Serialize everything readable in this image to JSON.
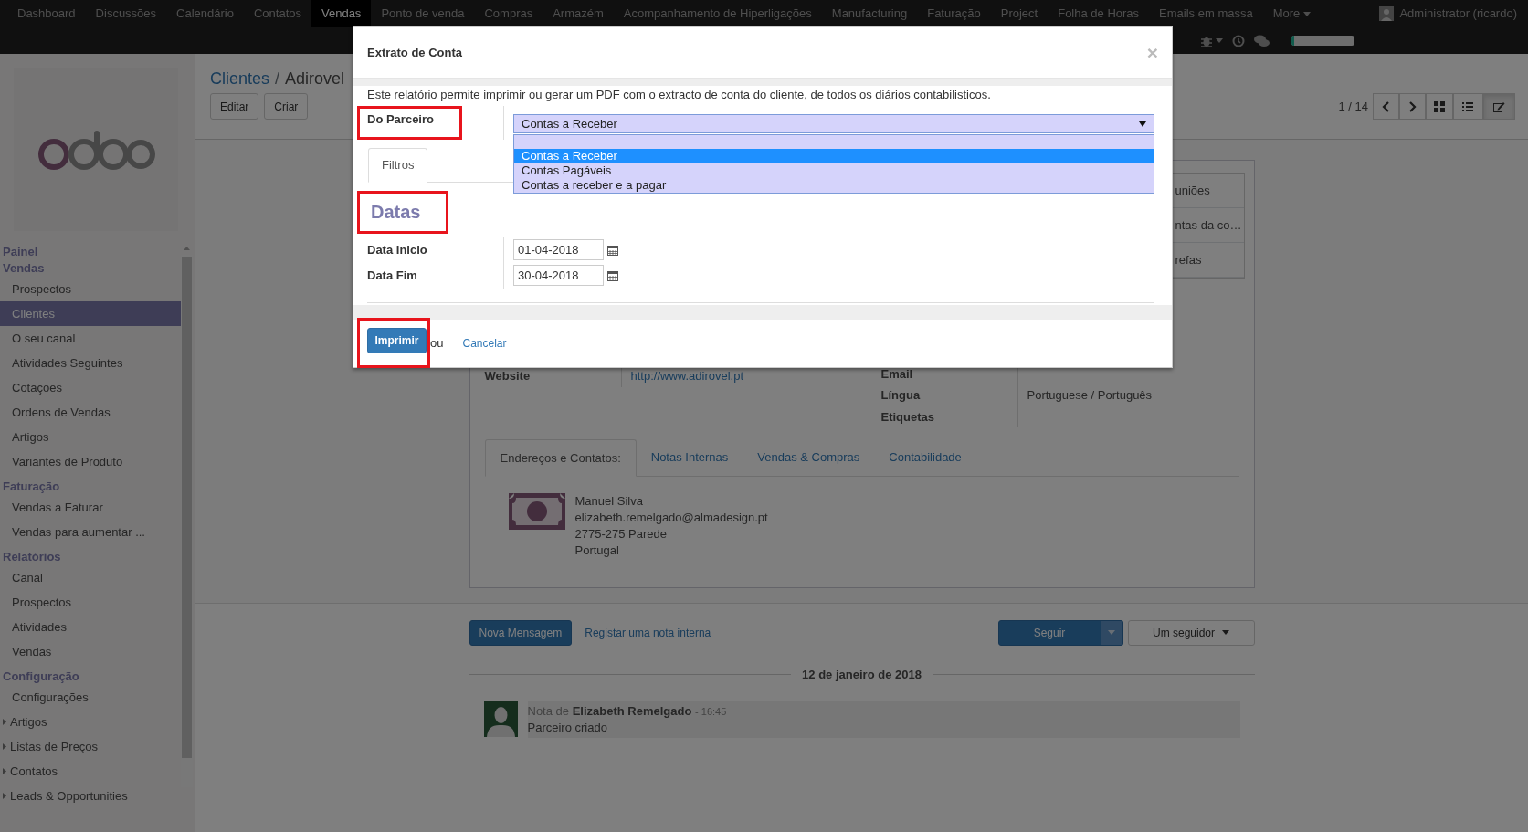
{
  "navbar": {
    "menu": [
      {
        "label": "Dashboard",
        "selected": false
      },
      {
        "label": "Discussões",
        "selected": false
      },
      {
        "label": "Calendário",
        "selected": false
      },
      {
        "label": "Contatos",
        "selected": false
      },
      {
        "label": "Vendas",
        "selected": true
      },
      {
        "label": "Ponto de venda",
        "selected": false
      },
      {
        "label": "Compras",
        "selected": false
      },
      {
        "label": "Armazém",
        "selected": false
      },
      {
        "label": "Acompanhamento de Hiperligações",
        "selected": false
      },
      {
        "label": "Manufacturing",
        "selected": false
      },
      {
        "label": "Faturação",
        "selected": false
      },
      {
        "label": "Project",
        "selected": false
      },
      {
        "label": "Folha de Horas",
        "selected": false
      },
      {
        "label": "Emails em massa",
        "selected": false
      }
    ],
    "more": "More",
    "user": "Administrator (ricardo)",
    "planner": {
      "level": 0.04
    }
  },
  "sidebar": {
    "sections": [
      {
        "title": "Painel"
      },
      {
        "title": "Vendas",
        "items": [
          {
            "label": "Prospectos",
            "selected": false,
            "expandable": false
          },
          {
            "label": "Clientes",
            "selected": true,
            "expandable": false
          },
          {
            "label": "O seu canal",
            "selected": false,
            "expandable": false
          },
          {
            "label": "Atividades Seguintes",
            "selected": false,
            "expandable": false
          },
          {
            "label": "Cotações",
            "selected": false,
            "expandable": false
          },
          {
            "label": "Ordens de Vendas",
            "selected": false,
            "expandable": false
          },
          {
            "label": "Artigos",
            "selected": false,
            "expandable": false
          },
          {
            "label": "Variantes de Produto",
            "selected": false,
            "expandable": false
          }
        ]
      },
      {
        "title": "Faturação",
        "items": [
          {
            "label": "Vendas a Faturar",
            "selected": false,
            "expandable": false
          },
          {
            "label": "Vendas para aumentar ...",
            "selected": false,
            "expandable": false
          }
        ]
      },
      {
        "title": "Relatórios",
        "items": [
          {
            "label": "Canal",
            "selected": false,
            "expandable": false
          },
          {
            "label": "Prospectos",
            "selected": false,
            "expandable": false
          },
          {
            "label": "Atividades",
            "selected": false,
            "expandable": false
          },
          {
            "label": "Vendas",
            "selected": false,
            "expandable": false
          }
        ]
      },
      {
        "title": "Configuração",
        "items": [
          {
            "label": "Configurações",
            "selected": false,
            "expandable": false
          },
          {
            "label": "Artigos",
            "selected": false,
            "expandable": true
          },
          {
            "label": "Listas de Preços",
            "selected": false,
            "expandable": true
          },
          {
            "label": "Contatos",
            "selected": false,
            "expandable": true
          },
          {
            "label": "Leads & Opportunities",
            "selected": false,
            "expandable": true
          }
        ]
      }
    ]
  },
  "control_panel": {
    "breadcrumb": [
      {
        "label": "Clientes",
        "link": true
      },
      {
        "label": "Adirovel",
        "link": false
      }
    ],
    "separator": "/",
    "buttons": [
      "Editar",
      "Criar"
    ],
    "pager": "1 / 14",
    "views": [
      {
        "kind": "kanban",
        "selected": false
      },
      {
        "kind": "list",
        "selected": false
      },
      {
        "kind": "form",
        "selected": true
      }
    ]
  },
  "form": {
    "button_box": [
      "uniões",
      "ntas da co…",
      "refas"
    ],
    "fields_left": [
      {
        "label": "Website",
        "value": "http://www.adirovel.pt"
      }
    ],
    "fields_right": [
      {
        "label": "Email"
      },
      {
        "label": "Língua",
        "value": "Portuguese / Português"
      },
      {
        "label": "Etiquetas"
      }
    ],
    "tabs": [
      {
        "label": "Endereços e Contatos:",
        "selected": true
      },
      {
        "label": "Notas Internas",
        "selected": false
      },
      {
        "label": "Vendas & Compras",
        "selected": false
      },
      {
        "label": "Contabilidade",
        "selected": false
      }
    ],
    "contact": {
      "lines": [
        "Manuel Silva",
        "elizabeth.remelgado@almadesign.pt",
        "2775-275 Parede",
        "Portugal"
      ]
    }
  },
  "chatter": {
    "new_message": "Nova Mensagem",
    "log_note": "Registar uma nota interna",
    "follow": "Seguir",
    "followers": "Um seguidor",
    "date": "12 de janeiro de 2018",
    "messages": [
      {
        "prefix": "Nota de",
        "author": "Elizabeth Remelgado",
        "time": "- 16:45",
        "body": "Parceiro criado"
      }
    ]
  },
  "modal": {
    "title": "Extrato de Conta",
    "close": "×",
    "intro": "Este relatório permite imprimir ou gerar um PDF com o extracto de conta do cliente, de todos os diários contabilisticos.",
    "partner": {
      "label": "Do Parceiro",
      "highlighted": true,
      "value": "Contas a Receber",
      "open": true,
      "blank_option": true,
      "options": [
        {
          "label": "Contas a Receber",
          "selected": true
        },
        {
          "label": "Contas Pagáveis",
          "selected": false
        },
        {
          "label": "Contas a receber e a pagar",
          "selected": false
        }
      ]
    },
    "tabs": [
      {
        "label": "Filtros",
        "selected": true
      }
    ],
    "section": {
      "title": "Datas",
      "highlighted": true
    },
    "dates": [
      {
        "label": "Data Inicio",
        "value": "01-04-2018"
      },
      {
        "label": "Data Fim",
        "value": "30-04-2018"
      }
    ],
    "print": {
      "label": "Imprimir",
      "highlighted": true
    },
    "or": "ou",
    "cancel": "Cancelar"
  }
}
